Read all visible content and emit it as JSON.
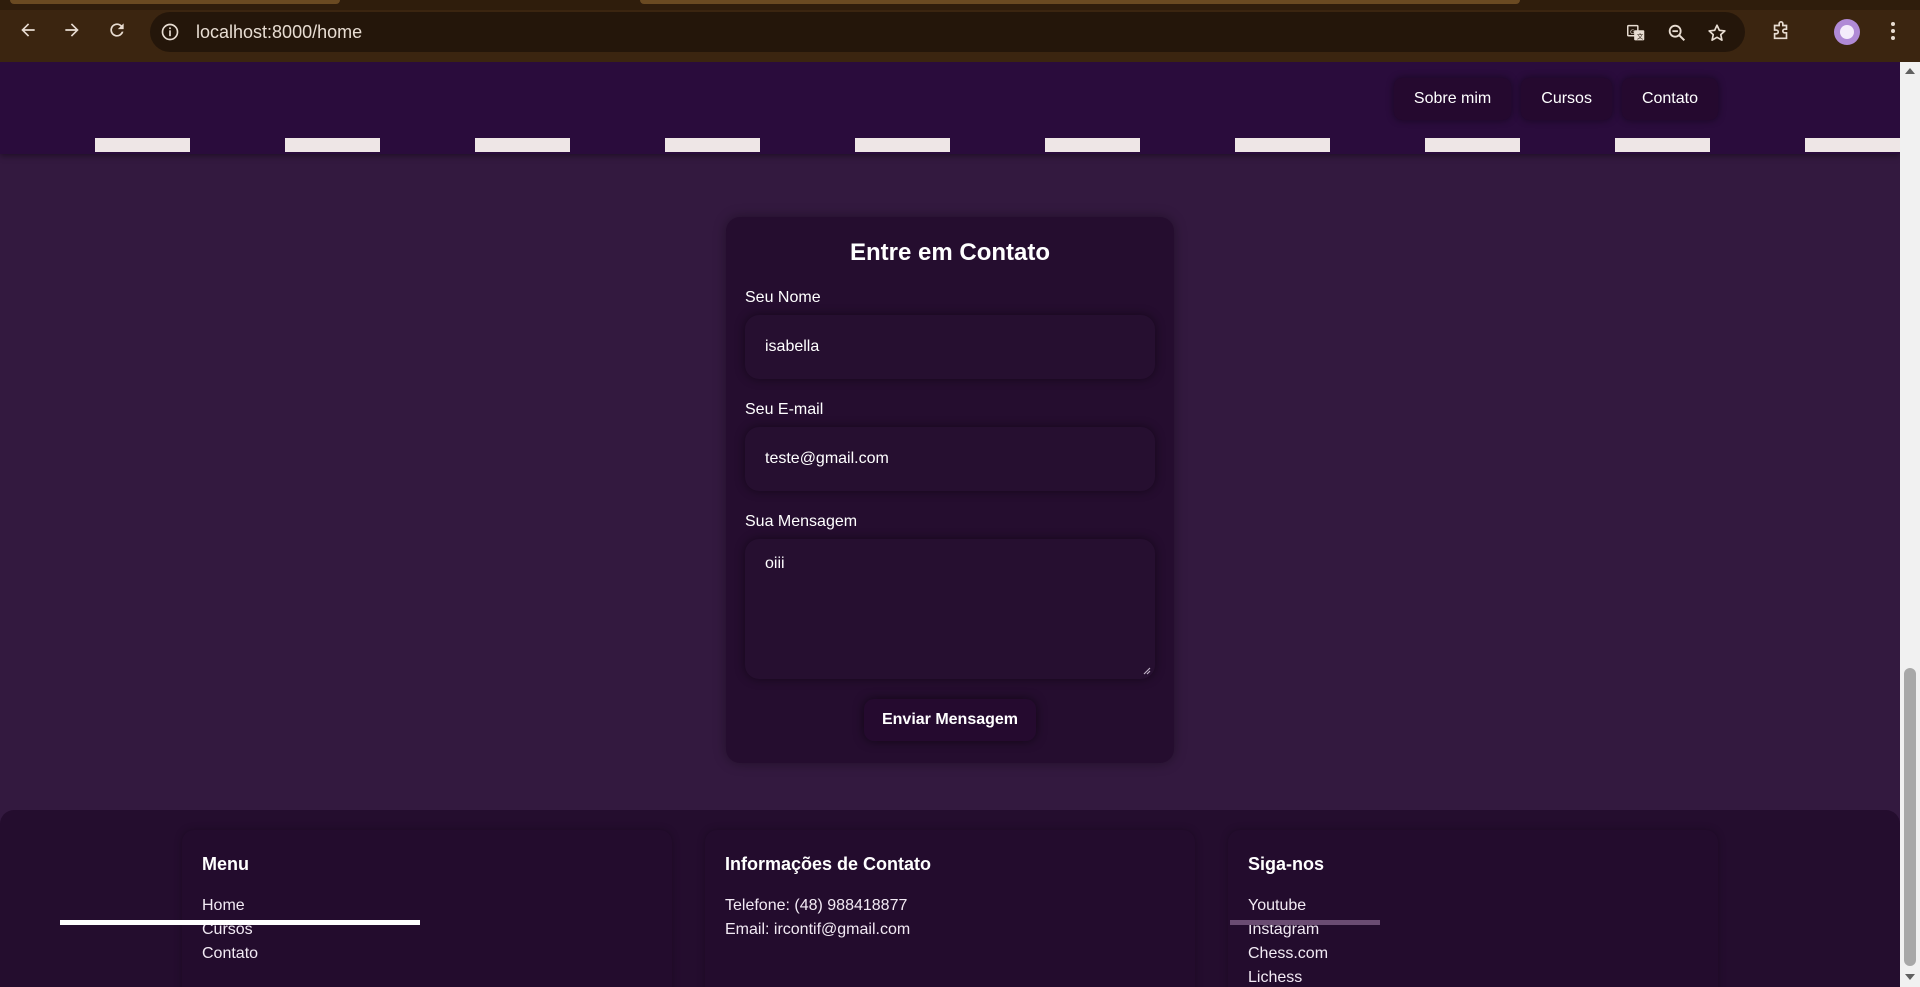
{
  "browser": {
    "url": "localhost:8000/home",
    "icons": {
      "back": "back-arrow-icon",
      "forward": "forward-arrow-icon",
      "reload": "reload-icon",
      "site_info": "info-icon",
      "translate": "translate-icon",
      "zoom": "zoom-icon",
      "bookmark": "star-icon",
      "extensions": "puzzle-icon",
      "profile": "avatar",
      "menu": "kebab-menu-icon"
    }
  },
  "header": {
    "nav": [
      "Sobre mim",
      "Cursos",
      "Contato"
    ]
  },
  "contact_form": {
    "title": "Entre em Contato",
    "name_label": "Seu Nome",
    "name_value": "isabella",
    "email_label": "Seu E-mail",
    "email_value": "teste@gmail.com",
    "message_label": "Sua Mensagem",
    "message_value": "oiii",
    "submit_label": "Enviar Mensagem"
  },
  "footer": {
    "menu": {
      "title": "Menu",
      "items": [
        "Home",
        "Cursos",
        "Contato"
      ]
    },
    "contact": {
      "title": "Informações de Contato",
      "items": [
        "Telefone: (48) 988418877",
        "Email: ircontif@gmail.com"
      ]
    },
    "social": {
      "title": "Siga-nos",
      "items": [
        "Youtube",
        "Instagram",
        "Chess.com",
        "Lichess"
      ]
    }
  },
  "colors": {
    "page_bg": "#33193f",
    "header_bg": "#2a0c3c",
    "card_bg": "#250d2f",
    "footer_bg": "#240d2e",
    "chrome_bg": "#3b2510"
  }
}
